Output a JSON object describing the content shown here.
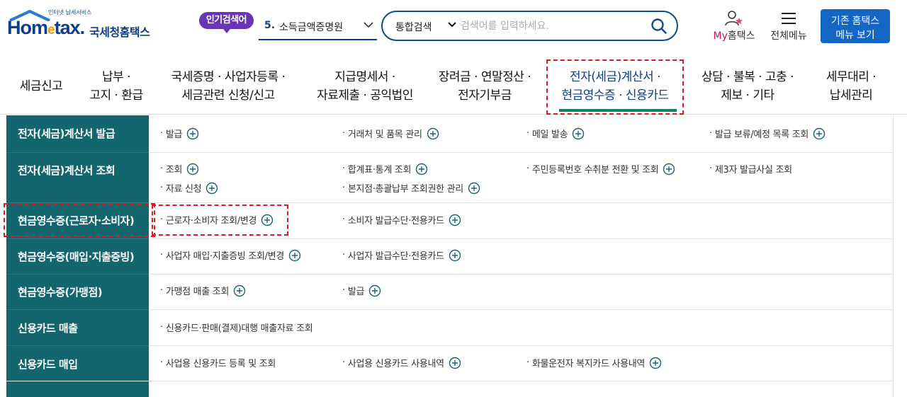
{
  "logo": {
    "small": "인터넷 납세서비스",
    "en_a": "Hom",
    "en_e": "e",
    "en_b": "tax.",
    "ko": "국세청홈택스"
  },
  "popular": {
    "badge": "인기검색어",
    "rank": "5.",
    "term": "소득금액증명원"
  },
  "search": {
    "select": "통합검색",
    "placeholder": "검색어를 입력하세요."
  },
  "header": {
    "my_a": "My",
    "my_b": "홈택스",
    "menu_all": "전체메뉴",
    "old_menu_1": "기존 홈택스",
    "old_menu_2": "메뉴 보기"
  },
  "gnb": [
    {
      "l1": "세금신고",
      "l2": ""
    },
    {
      "l1": "납부 ·",
      "l2": "고지 · 환급"
    },
    {
      "l1": "국세증명 · 사업자등록 ·",
      "l2": "세금관련 신청/신고"
    },
    {
      "l1": "지급명세서 ·",
      "l2": "자료제출 · 공익법인"
    },
    {
      "l1": "장려금 · 연말정산 ·",
      "l2": "전자기부금"
    },
    {
      "l1": "전자(세금)계산서 ·",
      "l2": "현금영수증 · 신용카드"
    },
    {
      "l1": "상담 · 불복 · 고충 ·",
      "l2": "제보 · 기타"
    },
    {
      "l1": "세무대리 ·",
      "l2": "납세관리"
    }
  ],
  "rows": [
    {
      "title": "전자(세금)계산서 발급",
      "links": [
        "발급",
        "거래처 및 품목 관리",
        "메일 발송",
        "발급 보류/예정 목록 조회"
      ]
    },
    {
      "title": "전자(세금)계산서 조회",
      "links": [
        "조회",
        "합계표·통계 조회",
        "주민등록번호 수취분 전환 및 조회",
        "제3자 발급사실 조회",
        "자료 신청",
        "본지점·총괄납부 조회권한 관리"
      ]
    },
    {
      "title": "현금영수증(근로자·소비자)",
      "links": [
        "근로자·소비자 조회/변경",
        "소비자 발급수단·전용카드"
      ]
    },
    {
      "title": "현금영수증(매입·지출증빙)",
      "links": [
        "사업자 매입·지출증빙 조회/변경",
        "사업자 발급수단·전용카드"
      ]
    },
    {
      "title": "현금영수증(가맹점)",
      "links": [
        "가맹점 매출 조회",
        "발급"
      ]
    },
    {
      "title": "신용카드 매출",
      "links": [
        "신용카드·판매(결제)대행 매출자료 조회"
      ]
    },
    {
      "title": "신용카드 매입",
      "links": [
        "사업용 신용카드 등록 및 조회",
        "사업용 신용카드 사용내역",
        "화물운전자 복지카드 사용내역"
      ]
    }
  ],
  "colors": {
    "accent": "#0b3e8c",
    "side": "#13656e",
    "highlight": "#e0191d",
    "underline": "#13806f"
  }
}
